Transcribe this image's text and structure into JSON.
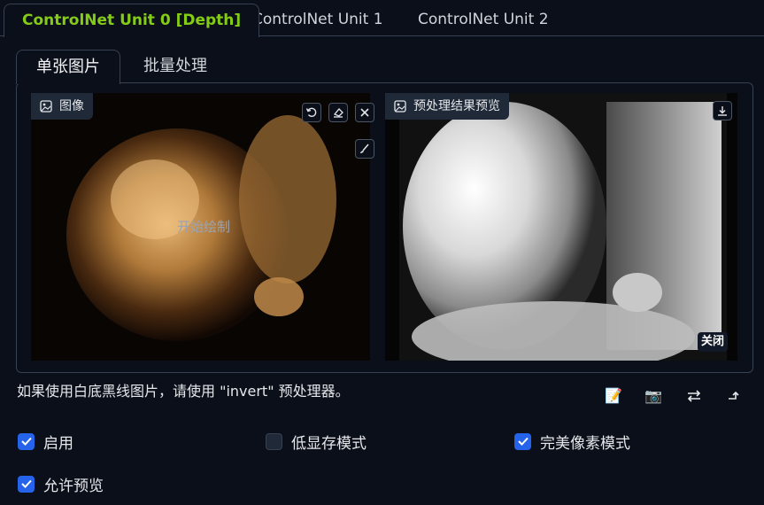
{
  "unit_tabs": [
    {
      "label": "ControlNet Unit 0 [Depth]",
      "active": true
    },
    {
      "label": "ControlNet Unit 1",
      "active": false
    },
    {
      "label": "ControlNet Unit 2",
      "active": false
    }
  ],
  "sub_tabs": [
    {
      "label": "单张图片",
      "active": true
    },
    {
      "label": "批量处理",
      "active": false
    }
  ],
  "input_image": {
    "label": "图像",
    "draw_hint": "开始绘制"
  },
  "preview_image": {
    "label": "预处理结果预览",
    "close_label": "关闭"
  },
  "hint": "如果使用白底黑线图片，请使用 \"invert\" 预处理器。",
  "action_icons": [
    "memo-icon",
    "camera-icon",
    "swap-icon",
    "send-up-icon"
  ],
  "checkboxes": [
    {
      "label": "启用",
      "checked": true
    },
    {
      "label": "低显存模式",
      "checked": false
    },
    {
      "label": "完美像素模式",
      "checked": true
    },
    {
      "label": "允许预览",
      "checked": true
    }
  ],
  "colors": {
    "accent": "#84cc16",
    "checkbox_on": "#2563eb",
    "background": "#0b0f19"
  }
}
